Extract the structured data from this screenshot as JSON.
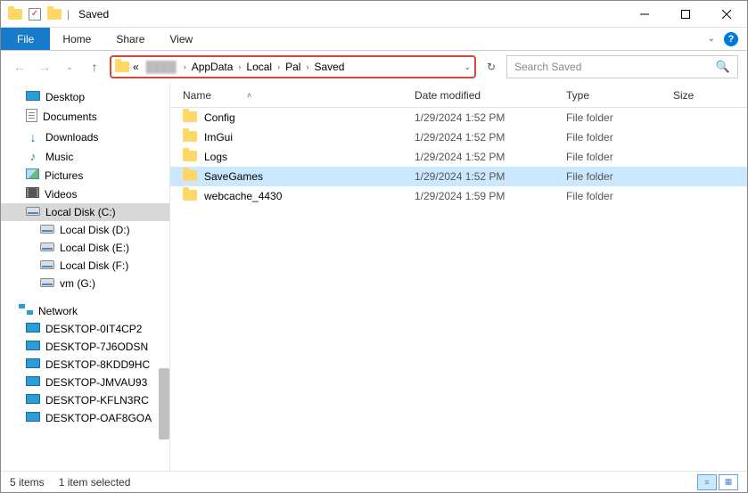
{
  "window": {
    "title": "Saved"
  },
  "ribbon": {
    "file": "File",
    "tabs": [
      "Home",
      "Share",
      "View"
    ]
  },
  "address": {
    "chevron": "«",
    "blurred_segment": "",
    "crumbs": [
      "AppData",
      "Local",
      "Pal",
      "Saved"
    ]
  },
  "search": {
    "placeholder": "Search Saved"
  },
  "columns": {
    "name": "Name",
    "date": "Date modified",
    "type": "Type",
    "size": "Size"
  },
  "tree": {
    "top": [
      {
        "label": "Desktop",
        "icon": "desktop"
      },
      {
        "label": "Documents",
        "icon": "doc"
      },
      {
        "label": "Downloads",
        "icon": "down"
      },
      {
        "label": "Music",
        "icon": "music"
      },
      {
        "label": "Pictures",
        "icon": "pic"
      },
      {
        "label": "Videos",
        "icon": "vid"
      },
      {
        "label": "Local Disk (C:)",
        "icon": "disk",
        "selected": true
      },
      {
        "label": "Local Disk (D:)",
        "icon": "disk",
        "depth": 1
      },
      {
        "label": "Local Disk (E:)",
        "icon": "disk",
        "depth": 1
      },
      {
        "label": "Local Disk (F:)",
        "icon": "disk",
        "depth": 1
      },
      {
        "label": "vm (G:)",
        "icon": "disk",
        "depth": 1
      }
    ],
    "network_label": "Network",
    "network_items": [
      "DESKTOP-0IT4CP2",
      "DESKTOP-7J6ODSN",
      "DESKTOP-8KDD9HC",
      "DESKTOP-JMVAU93",
      "DESKTOP-KFLN3RC",
      "DESKTOP-OAF8GOA"
    ]
  },
  "files": [
    {
      "name": "Config",
      "date": "1/29/2024 1:52 PM",
      "type": "File folder"
    },
    {
      "name": "ImGui",
      "date": "1/29/2024 1:52 PM",
      "type": "File folder"
    },
    {
      "name": "Logs",
      "date": "1/29/2024 1:52 PM",
      "type": "File folder"
    },
    {
      "name": "SaveGames",
      "date": "1/29/2024 1:52 PM",
      "type": "File folder",
      "selected": true
    },
    {
      "name": "webcache_4430",
      "date": "1/29/2024 1:59 PM",
      "type": "File folder"
    }
  ],
  "status": {
    "count": "5 items",
    "selected": "1 item selected"
  }
}
